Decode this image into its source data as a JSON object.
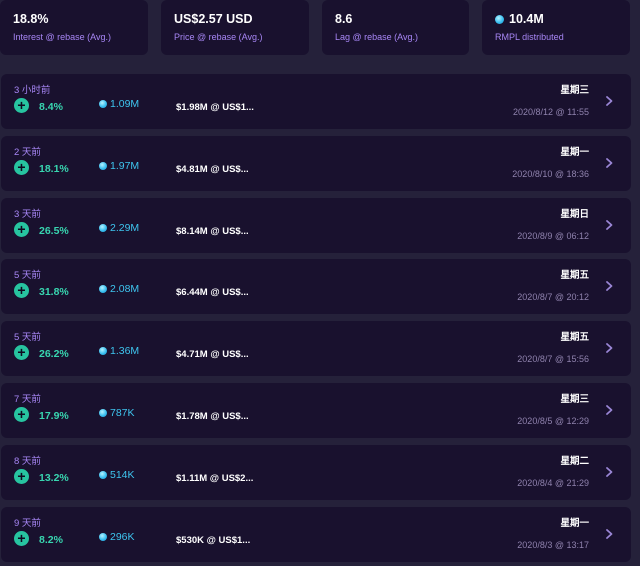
{
  "stats": [
    {
      "value": "18.8%",
      "label": "Interest @ rebase (Avg.)",
      "icon": ""
    },
    {
      "value": "US$2.57 USD",
      "label": "Price @ rebase (Avg.)",
      "icon": ""
    },
    {
      "value": "8.6",
      "label": "Lag @ rebase (Avg.)",
      "icon": ""
    },
    {
      "value": "10.4M",
      "label": "RMPL distributed",
      "icon": "coin-dot-icon"
    }
  ],
  "rows": [
    {
      "ago": "3 小时前",
      "pct": "8.4%",
      "dist": "1.09M",
      "mcap": "$1.98M @ US$1...",
      "weekday": "星期三",
      "time": "2020/8/12 @ 11:55"
    },
    {
      "ago": "2 天前",
      "pct": "18.1%",
      "dist": "1.97M",
      "mcap": "$4.81M @ US$...",
      "weekday": "星期一",
      "time": "2020/8/10 @ 18:36"
    },
    {
      "ago": "3 天前",
      "pct": "26.5%",
      "dist": "2.29M",
      "mcap": "$8.14M @ US$...",
      "weekday": "星期日",
      "time": "2020/8/9 @ 06:12"
    },
    {
      "ago": "5 天前",
      "pct": "31.8%",
      "dist": "2.08M",
      "mcap": "$6.44M @ US$...",
      "weekday": "星期五",
      "time": "2020/8/7 @ 20:12"
    },
    {
      "ago": "5 天前",
      "pct": "26.2%",
      "dist": "1.36M",
      "mcap": "$4.71M @ US$...",
      "weekday": "星期五",
      "time": "2020/8/7 @ 15:56"
    },
    {
      "ago": "7 天前",
      "pct": "17.9%",
      "dist": "787K",
      "mcap": "$1.78M @ US$...",
      "weekday": "星期三",
      "time": "2020/8/5 @ 12:29"
    },
    {
      "ago": "8 天前",
      "pct": "13.2%",
      "dist": "514K",
      "mcap": "$1.11M @ US$2...",
      "weekday": "星期二",
      "time": "2020/8/4 @ 21:29"
    },
    {
      "ago": "9 天前",
      "pct": "8.2%",
      "dist": "296K",
      "mcap": "$530K @ US$1...",
      "weekday": "星期一",
      "time": "2020/8/3 @ 13:17"
    }
  ],
  "icons": {
    "plus": "+",
    "chevron": "chevron-right-icon",
    "coin": "coin-dot-icon"
  },
  "colors": {
    "background": "#25213a",
    "card": "#19112e",
    "accent_purple": "#a786f5",
    "positive": "#27c4a0",
    "coin_blue": "#3ec5ef"
  }
}
